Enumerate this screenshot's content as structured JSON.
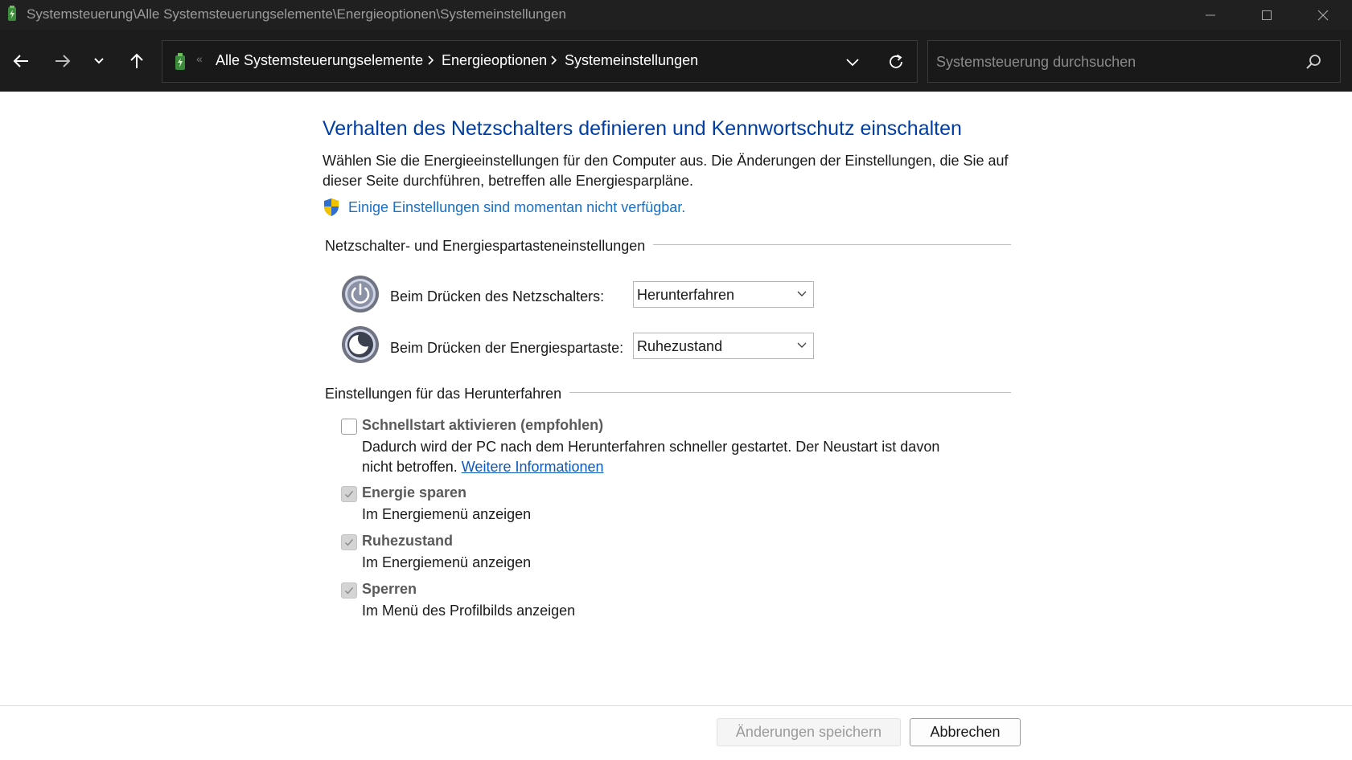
{
  "window": {
    "title": "Systemsteuerung\\Alle Systemsteuerungselemente\\Energieoptionen\\Systemeinstellungen"
  },
  "nav": {
    "breadcrumbs": [
      "Alle Systemsteuerungselemente",
      "Energieoptionen",
      "Systemeinstellungen"
    ],
    "search_placeholder": "Systemsteuerung durchsuchen"
  },
  "page": {
    "heading": "Verhalten des Netzschalters definieren und Kennwortschutz einschalten",
    "description": "Wählen Sie die Energieeinstellungen für den Computer aus. Die Änderungen der Einstellungen, die Sie auf dieser Seite durchführen, betreffen alle Energiesparpläne.",
    "unavailable_link": "Einige Einstellungen sind momentan nicht verfügbar."
  },
  "buttons_section": {
    "title": "Netzschalter- und Energiespartasteneinstellungen",
    "rows": [
      {
        "label": "Beim Drücken des Netzschalters:",
        "value": "Herunterfahren"
      },
      {
        "label": "Beim Drücken der Energiespartaste:",
        "value": "Ruhezustand"
      }
    ]
  },
  "shutdown_section": {
    "title": "Einstellungen für das Herunterfahren",
    "options": [
      {
        "title": "Schnellstart aktivieren (empfohlen)",
        "checked": false,
        "desc": "Dadurch wird der PC nach dem Herunterfahren schneller gestartet. Der Neustart ist davon nicht betroffen.",
        "link": "Weitere Informationen"
      },
      {
        "title": "Energie sparen",
        "checked": true,
        "desc": "Im Energiemenü anzeigen"
      },
      {
        "title": "Ruhezustand",
        "checked": true,
        "desc": "Im Energiemenü anzeigen"
      },
      {
        "title": "Sperren",
        "checked": true,
        "desc": "Im Menü des Profilbilds anzeigen"
      }
    ]
  },
  "footer": {
    "save_label": "Änderungen speichern",
    "cancel_label": "Abbrechen"
  },
  "colors": {
    "heading": "#003da5",
    "link": "#1a6fc9",
    "titlebar": "#202020",
    "navbar": "#1c1c1c"
  },
  "icons": [
    "app-icon",
    "minimize-icon",
    "maximize-icon",
    "close-icon",
    "back-arrow-icon",
    "forward-arrow-icon",
    "chevron-down-icon",
    "up-arrow-icon",
    "refresh-icon",
    "search-icon",
    "uac-shield-icon",
    "power-icon",
    "sleep-icon",
    "checkmark-icon"
  ]
}
